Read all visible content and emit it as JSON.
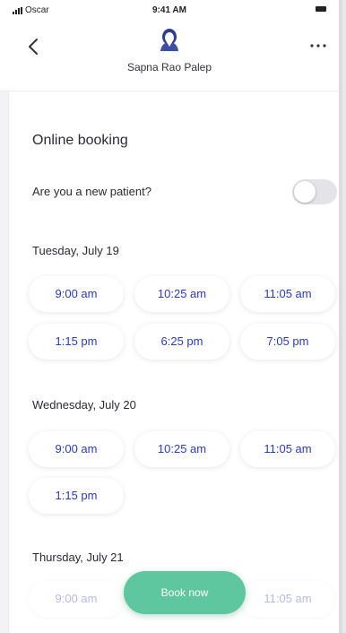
{
  "status_bar": {
    "carrier": "Oscar",
    "time": "9:41 AM"
  },
  "header": {
    "doctor_name": "Sapna Rao Palep",
    "back_icon": "chevron-left-icon",
    "more_icon": "more-horizontal-icon"
  },
  "booking": {
    "title": "Online booking",
    "new_patient_question": "Are you a new patient?",
    "new_patient_toggle_on": false,
    "days": [
      {
        "label": "Tuesday, July 19",
        "slots": [
          "9:00 am",
          "10:25 am",
          "11:05 am",
          "1:15 pm",
          "6:25 pm",
          "7:05 pm"
        ]
      },
      {
        "label": "Wednesday, July 20",
        "slots": [
          "9:00 am",
          "10:25 am",
          "11:05 am",
          "1:15 pm"
        ]
      },
      {
        "label": "Thursday, July 21",
        "slots": [
          "9:00 am",
          "11:05 am"
        ]
      }
    ],
    "book_now_label": "Book now"
  },
  "colors": {
    "slot_text": "#2a3bbf",
    "book_now": "#5ec7a0",
    "toggle_off": "#e4e4e8"
  }
}
